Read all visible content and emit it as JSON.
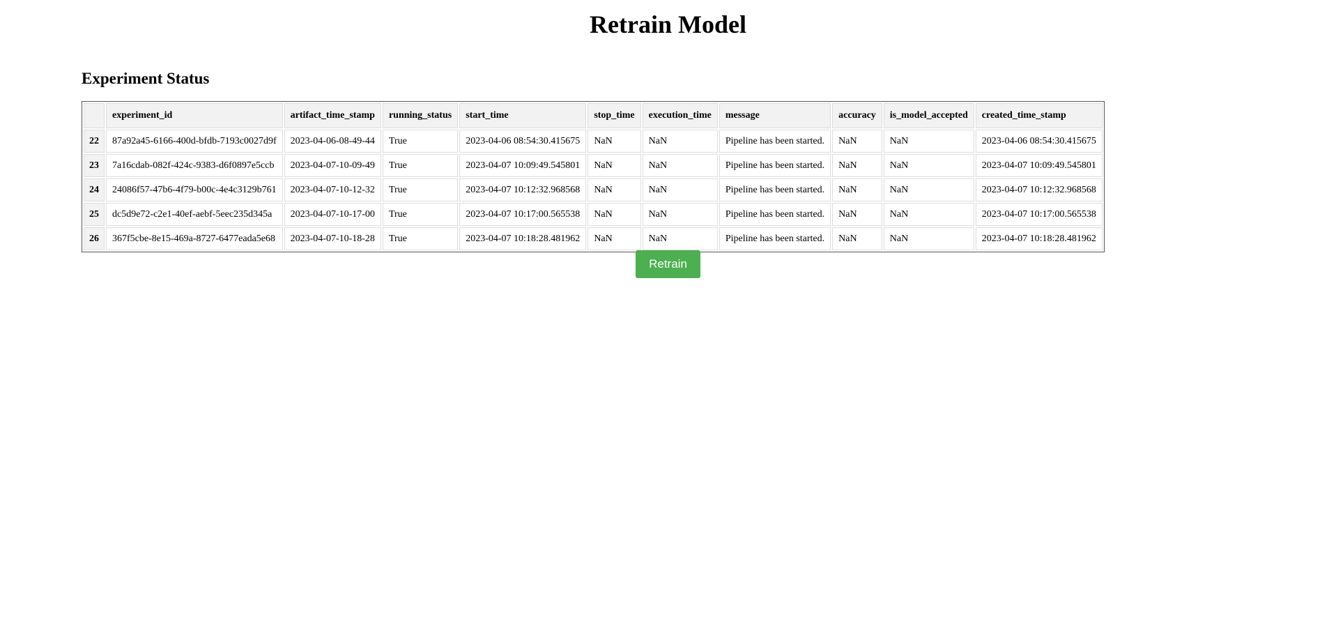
{
  "page": {
    "title": "Retrain Model"
  },
  "section": {
    "title": "Experiment Status"
  },
  "table": {
    "columns": [
      "",
      "experiment_id",
      "artifact_time_stamp",
      "running_status",
      "start_time",
      "stop_time",
      "execution_time",
      "message",
      "accuracy",
      "is_model_accepted",
      "created_time_stamp"
    ],
    "rows": [
      {
        "index": "22",
        "experiment_id": "87a92a45-6166-400d-bfdb-7193c0027d9f",
        "artifact_time_stamp": "2023-04-06-08-49-44",
        "running_status": "True",
        "start_time": "2023-04-06 08:54:30.415675",
        "stop_time": "NaN",
        "execution_time": "NaN",
        "message": "Pipeline has been started.",
        "accuracy": "NaN",
        "is_model_accepted": "NaN",
        "created_time_stamp": "2023-04-06 08:54:30.415675"
      },
      {
        "index": "23",
        "experiment_id": "7a16cdab-082f-424c-9383-d6f0897e5ccb",
        "artifact_time_stamp": "2023-04-07-10-09-49",
        "running_status": "True",
        "start_time": "2023-04-07 10:09:49.545801",
        "stop_time": "NaN",
        "execution_time": "NaN",
        "message": "Pipeline has been started.",
        "accuracy": "NaN",
        "is_model_accepted": "NaN",
        "created_time_stamp": "2023-04-07 10:09:49.545801"
      },
      {
        "index": "24",
        "experiment_id": "24086f57-47b6-4f79-b00c-4e4c3129b761",
        "artifact_time_stamp": "2023-04-07-10-12-32",
        "running_status": "True",
        "start_time": "2023-04-07 10:12:32.968568",
        "stop_time": "NaN",
        "execution_time": "NaN",
        "message": "Pipeline has been started.",
        "accuracy": "NaN",
        "is_model_accepted": "NaN",
        "created_time_stamp": "2023-04-07 10:12:32.968568"
      },
      {
        "index": "25",
        "experiment_id": "dc5d9e72-c2e1-40ef-aebf-5eec235d345a",
        "artifact_time_stamp": "2023-04-07-10-17-00",
        "running_status": "True",
        "start_time": "2023-04-07 10:17:00.565538",
        "stop_time": "NaN",
        "execution_time": "NaN",
        "message": "Pipeline has been started.",
        "accuracy": "NaN",
        "is_model_accepted": "NaN",
        "created_time_stamp": "2023-04-07 10:17:00.565538"
      },
      {
        "index": "26",
        "experiment_id": "367f5cbe-8e15-469a-8727-6477eada5e68",
        "artifact_time_stamp": "2023-04-07-10-18-28",
        "running_status": "True",
        "start_time": "2023-04-07 10:18:28.481962",
        "stop_time": "NaN",
        "execution_time": "NaN",
        "message": "Pipeline has been started.",
        "accuracy": "NaN",
        "is_model_accepted": "NaN",
        "created_time_stamp": "2023-04-07 10:18:28.481962"
      }
    ]
  },
  "actions": {
    "retrain_label": "Retrain",
    "button_color": "#4caf50"
  }
}
